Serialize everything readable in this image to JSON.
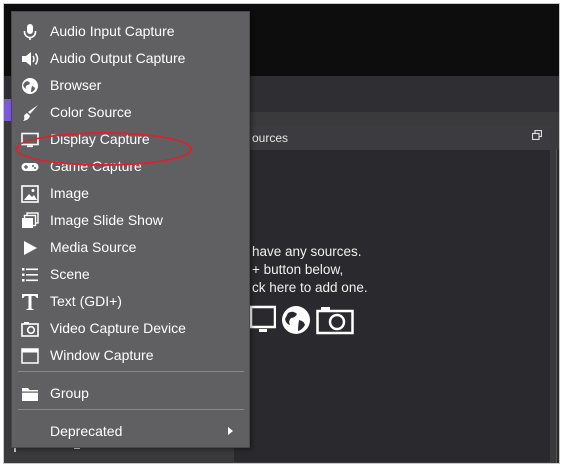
{
  "menu": {
    "items": [
      {
        "label": "Audio Input Capture",
        "icon": "microphone-icon"
      },
      {
        "label": "Audio Output Capture",
        "icon": "speaker-icon"
      },
      {
        "label": "Browser",
        "icon": "globe-icon"
      },
      {
        "label": "Color Source",
        "icon": "brush-icon"
      },
      {
        "label": "Display Capture",
        "icon": "monitor-icon"
      },
      {
        "label": "Game Capture",
        "icon": "gamepad-icon"
      },
      {
        "label": "Image",
        "icon": "image-icon"
      },
      {
        "label": "Image Slide Show",
        "icon": "slideshow-icon"
      },
      {
        "label": "Media Source",
        "icon": "play-icon"
      },
      {
        "label": "Scene",
        "icon": "list-icon"
      },
      {
        "label": "Text (GDI+)",
        "icon": "text-icon"
      },
      {
        "label": "Video Capture Device",
        "icon": "camera-icon"
      },
      {
        "label": "Window Capture",
        "icon": "window-icon"
      }
    ],
    "group_label": "Group",
    "deprecated_label": "Deprecated"
  },
  "sources": {
    "title": "ources",
    "empty_line1": "have any sources.",
    "empty_line2": "+ button below,",
    "empty_line3": "ck here to add one."
  },
  "colors": {
    "menu_bg": "#606062",
    "highlight": "#e0202a",
    "dock_bg": "#2a2a2e"
  }
}
